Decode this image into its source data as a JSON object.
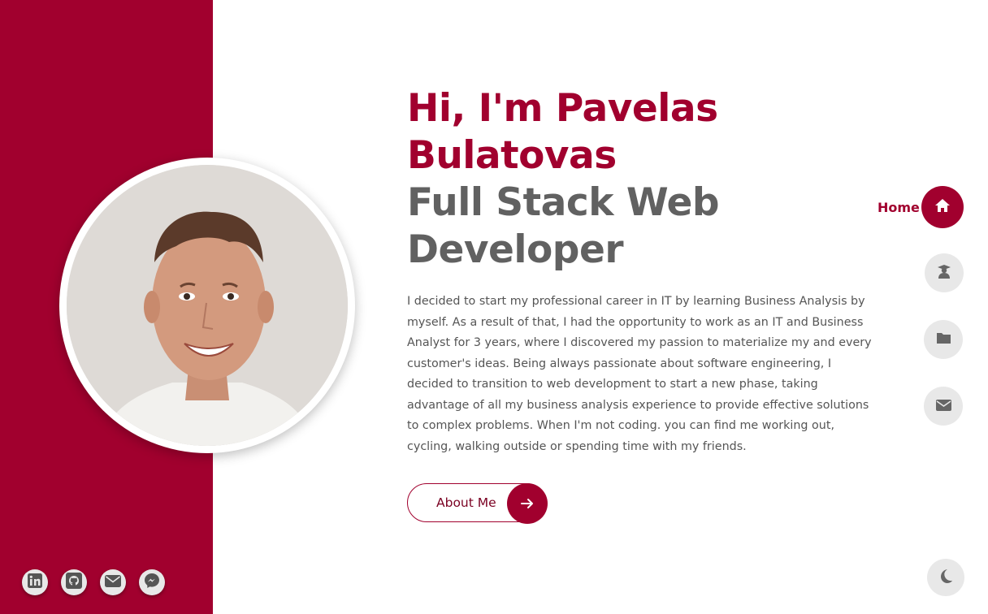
{
  "hero": {
    "greeting": "Hi, I'm Pavelas Bulatovas",
    "role": "Full Stack Web Developer",
    "intro": "I decided to start my professional career in IT by learning Business Analysis by myself. As a result of that, I had the opportunity to work as an IT and Business Analyst for 3 years, where I discovered my passion to materialize my and every customer's ideas. Being always passionate about software engineering, I decided to transition to web development to start a new phase, taking advantage of all my business analysis experience to provide effective solutions to complex problems. When I'm not coding. you can find me working out, cycling, walking outside or spending time with my friends.",
    "cta_label": "About Me",
    "cta_icon": "arrow-right-icon"
  },
  "nav": {
    "active_label": "Home",
    "items": [
      {
        "name": "home",
        "icon": "home-icon",
        "active": true
      },
      {
        "name": "education",
        "icon": "graduate-icon",
        "active": false
      },
      {
        "name": "portfolio",
        "icon": "folder-icon",
        "active": false
      },
      {
        "name": "contact",
        "icon": "envelope-icon",
        "active": false
      }
    ]
  },
  "socials": [
    {
      "name": "linkedin",
      "icon": "linkedin-icon"
    },
    {
      "name": "github",
      "icon": "github-icon"
    },
    {
      "name": "email",
      "icon": "envelope-icon"
    },
    {
      "name": "messenger",
      "icon": "messenger-icon"
    }
  ],
  "theme_toggle": {
    "icon": "moon-icon"
  },
  "colors": {
    "accent": "#a1002e",
    "heading_gray": "#616161",
    "text_gray": "#555555",
    "icon_bg": "#e8e8e8"
  }
}
